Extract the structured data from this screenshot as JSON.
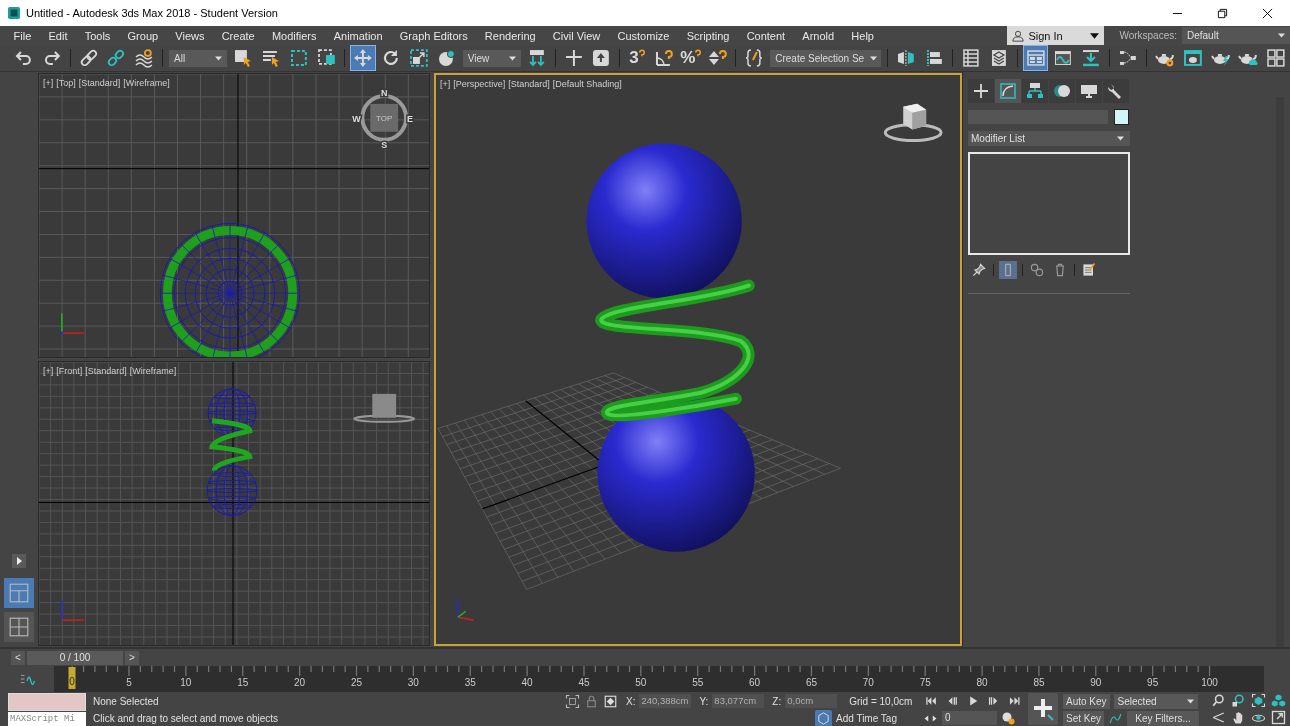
{
  "window": {
    "title": "Untitled - Autodesk 3ds Max 2018 - Student Version"
  },
  "menu_bar": [
    "File",
    "Edit",
    "Tools",
    "Group",
    "Views",
    "Create",
    "Modifiers",
    "Animation",
    "Graph Editors",
    "Rendering",
    "Civil View",
    "Customize",
    "Scripting",
    "Content",
    "Arnold",
    "Help"
  ],
  "account": {
    "label": "Sign In"
  },
  "workspaces": {
    "label": "Workspaces:",
    "value": "Default"
  },
  "toolbar": [
    {
      "kind": "undo",
      "selected": false
    },
    {
      "kind": "redo",
      "selected": false
    },
    {
      "kind": "separator"
    },
    {
      "kind": "link",
      "selected": false
    },
    {
      "kind": "unlink",
      "selected": false
    },
    {
      "kind": "bind",
      "selected": false
    },
    {
      "kind": "separator"
    },
    {
      "kind": "dropdown",
      "value": "All"
    },
    {
      "kind": "select",
      "selected": false
    },
    {
      "kind": "selectname",
      "selected": false
    },
    {
      "kind": "region",
      "selected": false
    },
    {
      "kind": "crossing",
      "selected": false
    },
    {
      "kind": "separator"
    },
    {
      "kind": "move",
      "selected": true
    },
    {
      "kind": "rotate",
      "selected": false
    },
    {
      "kind": "scale",
      "selected": false
    },
    {
      "kind": "placement",
      "selected": false
    },
    {
      "kind": "dropdown",
      "value": "View"
    },
    {
      "kind": "pivot",
      "selected": false
    },
    {
      "kind": "separator"
    },
    {
      "kind": "manipulate",
      "selected": false
    },
    {
      "kind": "keyboard",
      "selected": false
    },
    {
      "kind": "separator"
    },
    {
      "kind": "snap",
      "label": "3",
      "selected": false
    },
    {
      "kind": "angle",
      "selected": false
    },
    {
      "kind": "snap",
      "label": "%",
      "selected": false
    },
    {
      "kind": "spinner",
      "selected": false
    },
    {
      "kind": "separator"
    },
    {
      "kind": "braces",
      "selected": false
    },
    {
      "kind": "dropdown",
      "value": "Create Selection Se"
    },
    {
      "kind": "separator"
    },
    {
      "kind": "mirror",
      "selected": false
    },
    {
      "kind": "align",
      "selected": false
    },
    {
      "kind": "separator"
    },
    {
      "kind": "layerlist",
      "selected": false
    },
    {
      "kind": "layers",
      "selected": false
    },
    {
      "kind": "separator"
    },
    {
      "kind": "ribbon",
      "selected": true
    },
    {
      "kind": "curve",
      "selected": false
    },
    {
      "kind": "schematic",
      "selected": false
    },
    {
      "kind": "separator"
    },
    {
      "kind": "material",
      "selected": false
    },
    {
      "kind": "separator"
    },
    {
      "kind": "rendersetup",
      "selected": false
    },
    {
      "kind": "framewindow",
      "selected": false
    },
    {
      "kind": "render",
      "selected": false
    },
    {
      "kind": "cloud",
      "selected": false
    },
    {
      "kind": "grid4",
      "selected": false
    }
  ],
  "viewport_layouts": [
    {
      "selected": true
    },
    {
      "selected": false
    }
  ],
  "viewports": [
    {
      "kind": "top",
      "labels": [
        "[+]",
        "[Top]",
        "[Standard]",
        "[Wireframe]"
      ],
      "active": false,
      "viewcube_label": "TOP",
      "compass": [
        "N",
        "E",
        "S",
        "W"
      ]
    },
    {
      "kind": "front",
      "labels": [
        "[+]",
        "[Front]",
        "[Standard]",
        "[Wireframe]"
      ],
      "active": false
    },
    {
      "kind": "perspective",
      "labels": [
        "[+]",
        "[Perspective]",
        "[Standard]",
        "[Default Shading]"
      ],
      "active": true
    }
  ],
  "command_panel": {
    "tabs": [
      {
        "kind": "create",
        "selected": false
      },
      {
        "kind": "modify",
        "selected": true
      },
      {
        "kind": "hierarchy",
        "selected": false
      },
      {
        "kind": "motion",
        "selected": false
      },
      {
        "kind": "display",
        "selected": false
      },
      {
        "kind": "utilities",
        "selected": false
      }
    ],
    "modifier_list": "Modifier List",
    "stack_tools": [
      {
        "kind": "pin",
        "selected": false
      },
      {
        "kind": "endresult",
        "selected": true
      },
      {
        "kind": "unique",
        "selected": false
      },
      {
        "kind": "remove",
        "selected": false
      },
      {
        "kind": "configure",
        "selected": false
      }
    ]
  },
  "time_slider": {
    "prev": "<",
    "value": "0 / 100",
    "next": ">",
    "level": 0
  },
  "frame_labels": [
    "0",
    "5",
    "10",
    "15",
    "20",
    "25",
    "30",
    "35",
    "40",
    "45",
    "50",
    "55",
    "60",
    "65",
    "70",
    "75",
    "80",
    "85",
    "90",
    "95",
    "100"
  ],
  "status_bar": {
    "mini_listener": "MAXScript Mi",
    "selection": "None Selected",
    "prompt": "Click and drag to select and move objects",
    "coordinates": [
      {
        "axis": "X:",
        "value": "240,388cm"
      },
      {
        "axis": "Y:",
        "value": "83,077cm"
      },
      {
        "axis": "Z:",
        "value": "0,0cm"
      }
    ],
    "grid": "Grid = 10,0cm",
    "time_tag": "Add Time Tag",
    "frame": "0",
    "auto_key": "Auto Key",
    "key_mode": "Selected",
    "set_key": "Set Key",
    "key_filters": "Key Filters..."
  }
}
